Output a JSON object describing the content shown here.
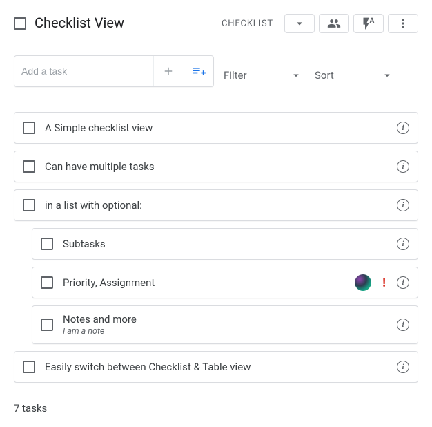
{
  "header": {
    "title": "Checklist View",
    "view_label": "CHECKLIST"
  },
  "add_task": {
    "placeholder": "Add a task"
  },
  "filters": {
    "filter_label": "Filter",
    "sort_label": "Sort"
  },
  "tasks": [
    {
      "title": "A Simple checklist view"
    },
    {
      "title": "Can have multiple tasks"
    },
    {
      "title": "in a list with optional:"
    },
    {
      "title": "Subtasks",
      "sub": true
    },
    {
      "title": "Priority, Assignment",
      "sub": true,
      "avatar": true,
      "priority": true
    },
    {
      "title": "Notes and more",
      "sub": true,
      "note": "I am a note"
    },
    {
      "title": "Easily switch between Checklist & Table view"
    }
  ],
  "footer": {
    "count_label": "7 tasks"
  }
}
